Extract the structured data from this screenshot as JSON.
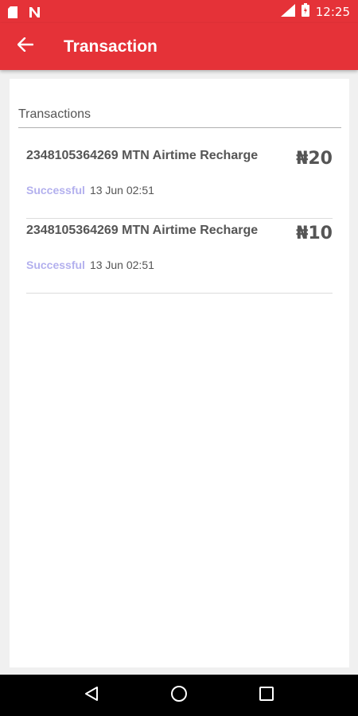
{
  "status_bar": {
    "time": "12:25",
    "network": "LTE",
    "icons": [
      "sim-card-icon",
      "notification-n-icon",
      "signal-icon",
      "battery-icon"
    ]
  },
  "app_bar": {
    "title": "Transaction",
    "back_icon": "arrow-left-icon",
    "color": "#e53238"
  },
  "section": {
    "header": "Transactions"
  },
  "transactions": [
    {
      "title": "2348105364269 MTN Airtime Recharge",
      "amount": "₦20",
      "status": "Successful",
      "date": "13 Jun 02:51"
    },
    {
      "title": "2348105364269 MTN Airtime Recharge",
      "amount": "₦10",
      "status": "Successful",
      "date": "13 Jun 02:51"
    }
  ],
  "nav_bar": {
    "icons": [
      "back-triangle-icon",
      "home-circle-icon",
      "recents-square-icon"
    ]
  },
  "colors": {
    "accent": "#e53238",
    "status_success": "#b3b0ee",
    "text": "#555555"
  }
}
